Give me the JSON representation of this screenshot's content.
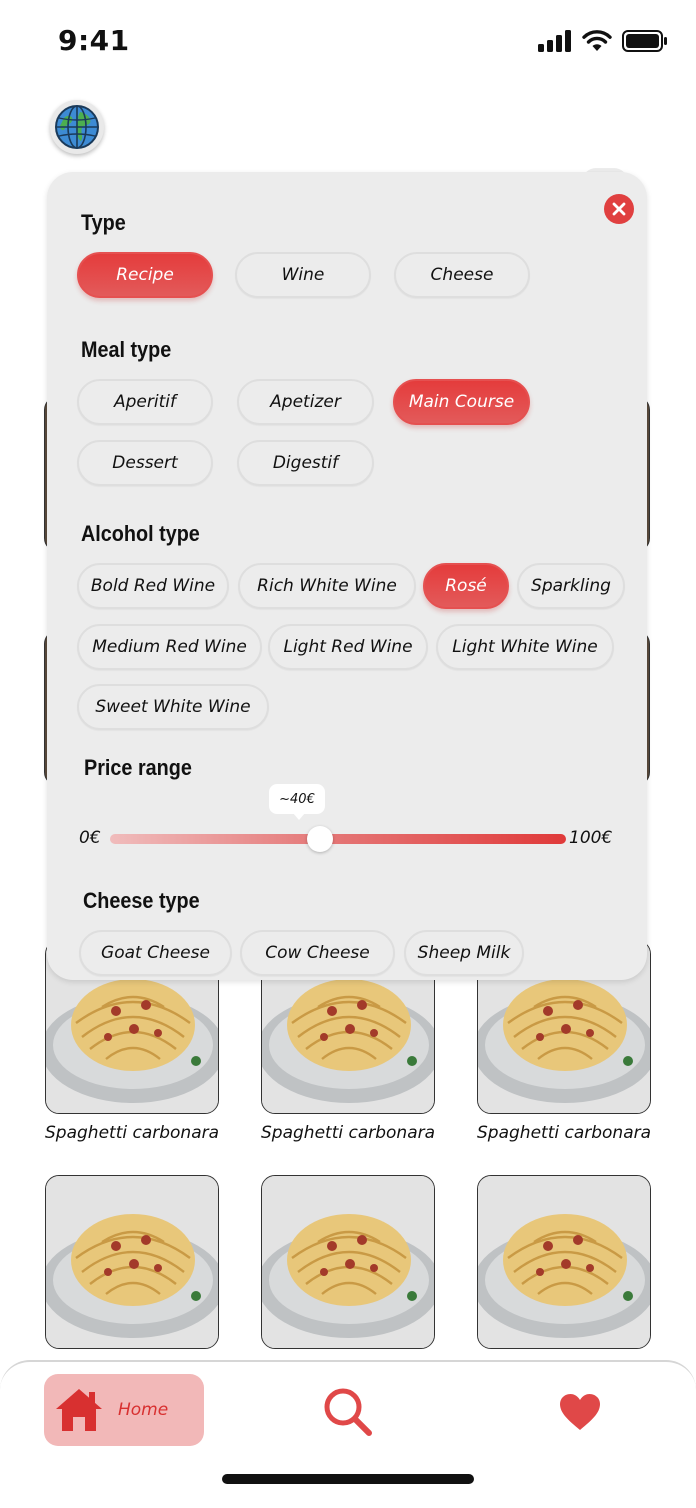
{
  "status_bar": {
    "time": "9:41"
  },
  "filters": {
    "type": {
      "title": "Type",
      "options": [
        {
          "label": "Recipe",
          "active": true
        },
        {
          "label": "Wine",
          "active": false
        },
        {
          "label": "Cheese",
          "active": false
        }
      ]
    },
    "meal_type": {
      "title": "Meal type",
      "options": [
        {
          "label": "Aperitif",
          "active": false
        },
        {
          "label": "Apetizer",
          "active": false
        },
        {
          "label": "Main Course",
          "active": true
        },
        {
          "label": "Dessert",
          "active": false
        },
        {
          "label": "Digestif",
          "active": false
        }
      ]
    },
    "alcohol_type": {
      "title": "Alcohol type",
      "options": [
        {
          "label": "Bold Red Wine",
          "active": false
        },
        {
          "label": "Rich White Wine",
          "active": false
        },
        {
          "label": "Rosé",
          "active": true
        },
        {
          "label": "Sparkling",
          "active": false
        },
        {
          "label": "Medium Red Wine",
          "active": false
        },
        {
          "label": "Light Red Wine",
          "active": false
        },
        {
          "label": "Light White Wine",
          "active": false
        },
        {
          "label": "Sweet White Wine",
          "active": false
        }
      ]
    },
    "price_range": {
      "title": "Price range",
      "min_label": "0€",
      "max_label": "100€",
      "value_label": "~40€",
      "value": 40,
      "min": 0,
      "max": 100
    },
    "cheese_type": {
      "title": "Cheese type",
      "options": [
        {
          "label": "Goat Cheese",
          "active": false
        },
        {
          "label": "Cow Cheese",
          "active": false
        },
        {
          "label": "Sheep Milk",
          "active": false
        }
      ]
    }
  },
  "results": [
    {
      "name": "Spaghetti carbonara"
    },
    {
      "name": "Spaghetti carbonara"
    },
    {
      "name": "Spaghetti carbonara"
    },
    {
      "name": ""
    },
    {
      "name": ""
    },
    {
      "name": ""
    }
  ],
  "bottom_nav": {
    "home_label": "Home",
    "icons": [
      "home-icon",
      "search-icon",
      "heart-icon"
    ]
  },
  "colors": {
    "accent": "#e03a3a",
    "panel_bg": "#ececec",
    "chip_border": "#dedede",
    "nav_active_bg": "#f2b8b8"
  }
}
